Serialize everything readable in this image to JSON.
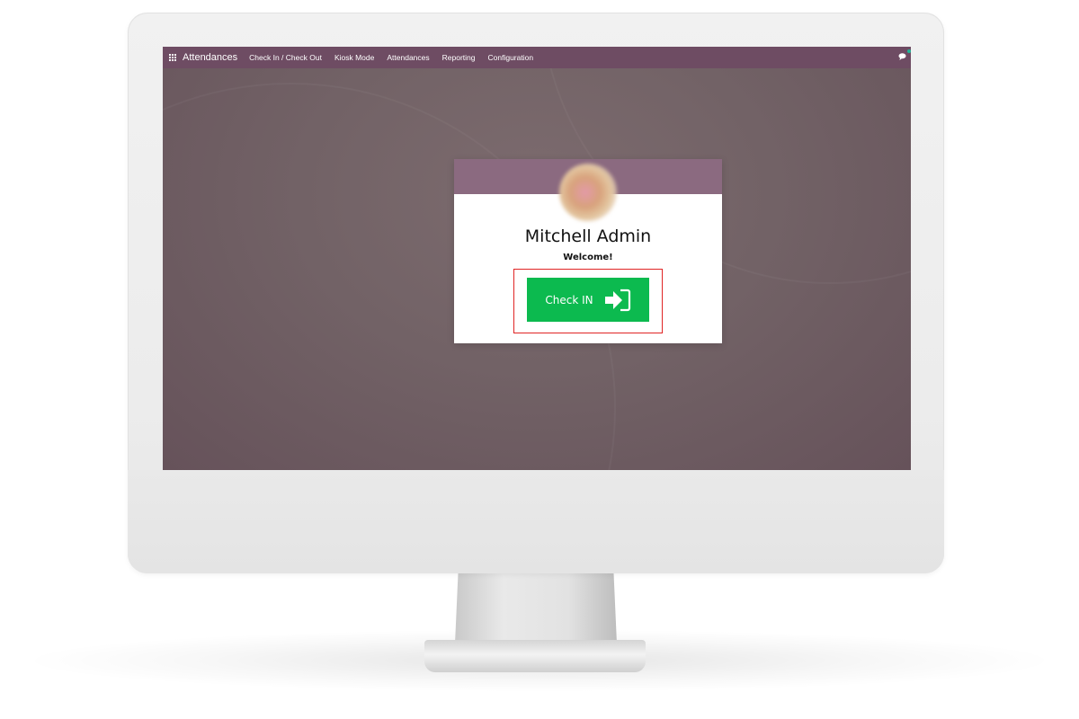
{
  "navbar": {
    "app_name": "Attendances",
    "menu": [
      {
        "label": "Check In / Check Out"
      },
      {
        "label": "Kiosk Mode"
      },
      {
        "label": "Attendances"
      },
      {
        "label": "Reporting"
      },
      {
        "label": "Configuration"
      }
    ],
    "icons": {
      "apps": "apps-grid-icon",
      "chat": "chat-icon"
    }
  },
  "kiosk": {
    "employee_name": "Mitchell Admin",
    "greeting": "Welcome!",
    "checkin_button_label": "Check IN",
    "checkin_icon": "sign-in-icon"
  },
  "colors": {
    "navbar": "#6e4c63",
    "card_header": "#8b6a80",
    "checkin_button": "#0cba4f",
    "highlight": "#e02424"
  }
}
